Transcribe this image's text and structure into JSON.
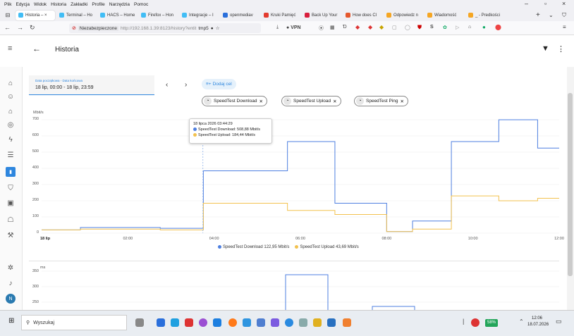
{
  "browser": {
    "menu": [
      "Plik",
      "Edycja",
      "Widok",
      "Historia",
      "Zakładki",
      "Profile",
      "Narzędzia",
      "Pomoc"
    ],
    "tabs": [
      {
        "label": "Historia – ×",
        "color": "#41bdf5",
        "active": true
      },
      {
        "label": "Terminal – Ho",
        "color": "#41bdf5"
      },
      {
        "label": "HACS – Home",
        "color": "#41bdf5"
      },
      {
        "label": "Firefox – Hon",
        "color": "#41bdf5"
      },
      {
        "label": "Integracje – I",
        "color": "#41bdf5"
      },
      {
        "label": "openmediav",
        "color": "#2a6fdb"
      },
      {
        "label": "Kruki Pamięć",
        "color": "#e33b2e"
      },
      {
        "label": "Back Up Your",
        "color": "#d81e3c"
      },
      {
        "label": "How does Cl",
        "color": "#e5582d"
      },
      {
        "label": "Odpowiedz n",
        "color": "#f5a623"
      },
      {
        "label": "Wiadomość",
        "color": "#f5a623"
      },
      {
        "label": "_ - Predkości",
        "color": "#f5a623"
      }
    ],
    "security_label": "Niezabezpieczone",
    "url": "http://192.168.1.39:8123/history?entit",
    "url_tail": "tmp5",
    "vpn_label": "VPN"
  },
  "app": {
    "title": "Historia",
    "date_range_label": "Data początkowa - Data końcowa",
    "date_range_value": "18 lip, 00:00 - 18 lip, 23:59",
    "add_target_label": "Dodaj cel",
    "chips": [
      "SpeedTest Download",
      "SpeedTest Upload",
      "SpeedTest Ping"
    ]
  },
  "chart1": {
    "unit": "Mbit/s",
    "yticks": [
      "700",
      "600",
      "500",
      "400",
      "300",
      "200",
      "100",
      "0"
    ],
    "xticks": [
      "18 lip",
      "02:00",
      "04:00",
      "06:00",
      "08:00",
      "10:00",
      "12:00"
    ],
    "tooltip_title": "18 lipca 2026 03:44:29",
    "tooltip_line1": "SpeedTest Download: 508,88 Mbit/s",
    "tooltip_line2": "SpeedTest Upload: 184,44 Mbit/s",
    "legend_download": "SpeedTest Download 122,95 Mbit/s",
    "legend_upload": "SpeedTest Upload 43,69 Mbit/s"
  },
  "chart2": {
    "unit": "ms",
    "yticks": [
      "350",
      "300",
      "250"
    ]
  },
  "chart_data": [
    {
      "type": "line",
      "ylabel": "Mbit/s",
      "ylim": [
        0,
        700
      ],
      "xlim_hours": [
        0,
        12
      ],
      "series": [
        {
          "name": "SpeedTest Download",
          "color": "#4e7fe0",
          "x": [
            0,
            0.9,
            0.9,
            2.75,
            2.75,
            3.75,
            3.75,
            5.7,
            5.7,
            6.8,
            6.8,
            8.0,
            8.0,
            8.6,
            8.6,
            9.5,
            9.5,
            10.6,
            10.6,
            11.5,
            11.5,
            12.0
          ],
          "y": [
            20,
            20,
            35,
            35,
            30,
            30,
            385,
            385,
            565,
            565,
            185,
            185,
            10,
            10,
            75,
            75,
            565,
            565,
            700,
            700,
            525,
            525
          ]
        },
        {
          "name": "SpeedTest Upload",
          "color": "#f2c14e",
          "x": [
            0,
            0.9,
            0.9,
            2.75,
            2.75,
            3.75,
            3.75,
            5.7,
            5.7,
            6.8,
            6.8,
            8.0,
            8.0,
            8.6,
            8.6,
            9.5,
            9.5,
            10.6,
            10.6,
            11.5,
            11.5,
            12.0
          ],
          "y": [
            20,
            20,
            25,
            25,
            20,
            20,
            185,
            185,
            140,
            140,
            115,
            115,
            10,
            10,
            25,
            25,
            230,
            230,
            200,
            200,
            215,
            215
          ]
        }
      ]
    }
  ],
  "taskbar": {
    "search_label": "Wyszukaj",
    "battery": "58%",
    "time": "12:06",
    "date": "18.07.2026"
  }
}
